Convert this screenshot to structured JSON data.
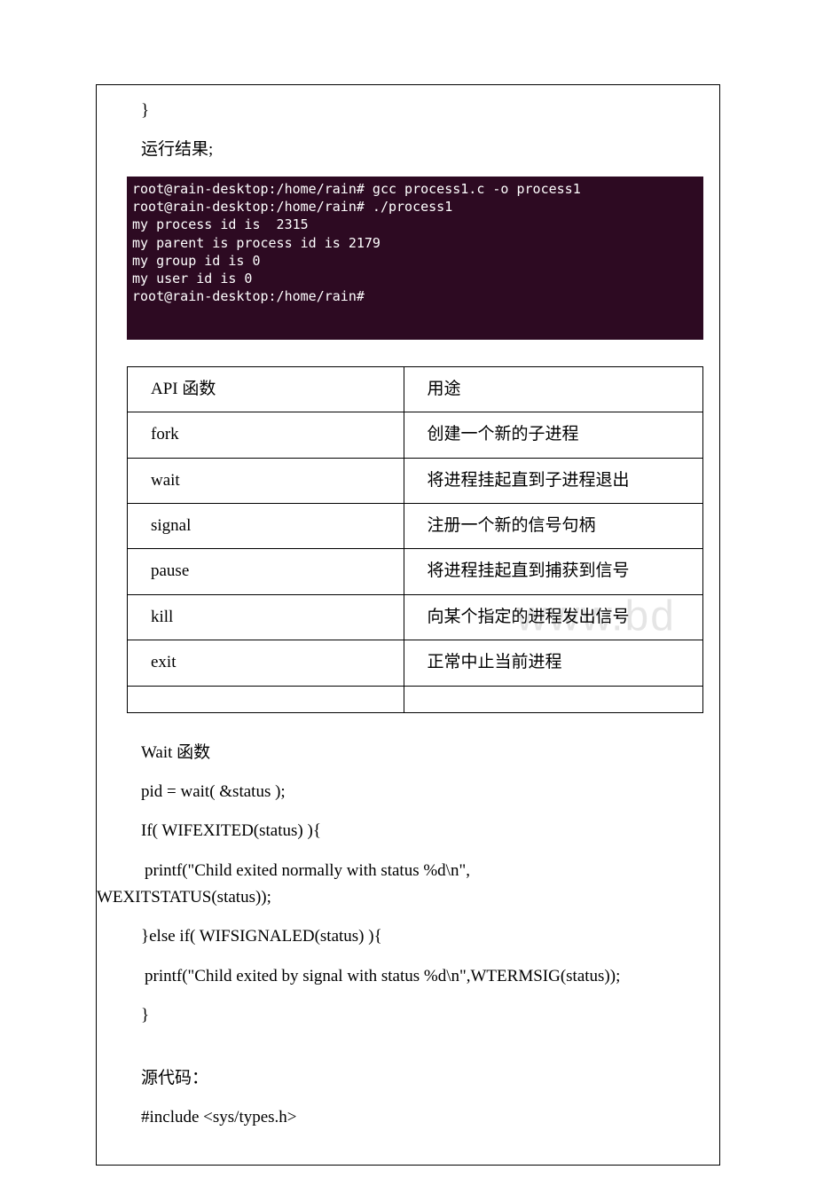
{
  "top": {
    "brace": "}",
    "run_label": "运行结果;"
  },
  "terminal": {
    "lines": [
      "root@rain-desktop:/home/rain# gcc process1.c -o process1",
      "root@rain-desktop:/home/rain# ./process1",
      "my process id is  2315",
      "my parent is process id is 2179",
      "my group id is 0",
      "my user id is 0",
      "root@rain-desktop:/home/rain#"
    ]
  },
  "table": {
    "header": {
      "c1": "API 函数",
      "c2": "用途"
    },
    "rows": [
      {
        "c1": "fork",
        "c2": "创建一个新的子进程"
      },
      {
        "c1": "wait",
        "c2": "将进程挂起直到子进程退出"
      },
      {
        "c1": "signal",
        "c2": "注册一个新的信号句柄"
      },
      {
        "c1": "pause",
        "c2": "将进程挂起直到捕获到信号"
      },
      {
        "c1": "kill",
        "c2": "向某个指定的进程发出信号"
      },
      {
        "c1": "exit",
        "c2": "正常中止当前进程"
      },
      {
        "c1": "",
        "c2": ""
      }
    ]
  },
  "watermark": "www.bd",
  "body": {
    "l1": "Wait 函数",
    "l2": "pid = wait( &status );",
    "l3": "If( WIFEXITED(status) ){",
    "l4a": " printf(\"Child exited normally with status %d\\n\",",
    "l4b": "WEXITSTATUS(status));",
    "l5": "}else if( WIFSIGNALED(status) ){",
    "l6": " printf(\"Child exited by signal with status %d\\n\",WTERMSIG(status));",
    "l7": "}",
    "l8": "源代码：",
    "l9": "#include <sys/types.h>"
  }
}
